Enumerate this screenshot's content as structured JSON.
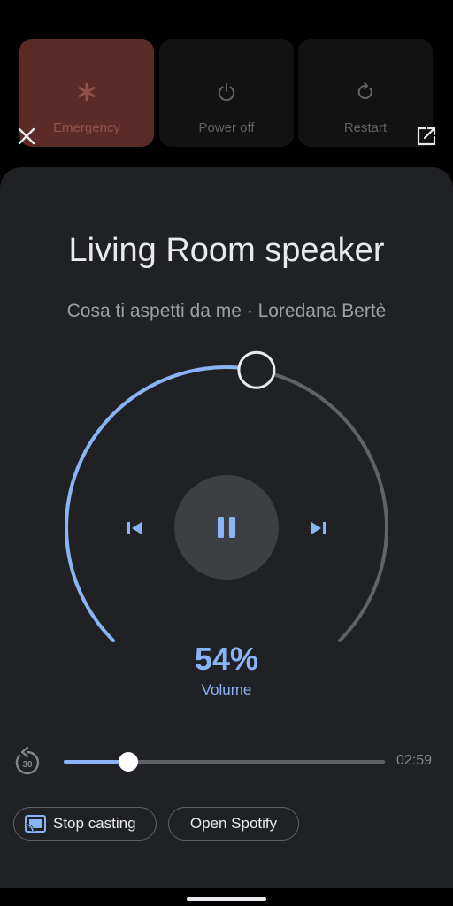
{
  "power_menu": {
    "emergency": {
      "label": "Emergency",
      "icon": "asterisk-icon"
    },
    "power_off": {
      "label": "Power off",
      "icon": "power-icon"
    },
    "restart": {
      "label": "Restart",
      "icon": "restart-icon"
    }
  },
  "controls": {
    "close_icon": "close-icon",
    "open_external_icon": "open-in-new-icon"
  },
  "media": {
    "device": "Living Room speaker",
    "song_info": "Cosa ti aspetti da me · Loredana Bertè",
    "volume_percent": 54,
    "volume_text": "54%",
    "volume_label": "Volume",
    "playback_state": "playing",
    "seek_progress": 0.2,
    "duration": "02:59",
    "replay_label": "30",
    "stop_casting": "Stop casting",
    "open_app": "Open Spotify"
  },
  "colors": {
    "accent": "#8ab4f8",
    "panel": "#202124",
    "emergency": "#5c2b27",
    "track_off": "#5f6368"
  }
}
